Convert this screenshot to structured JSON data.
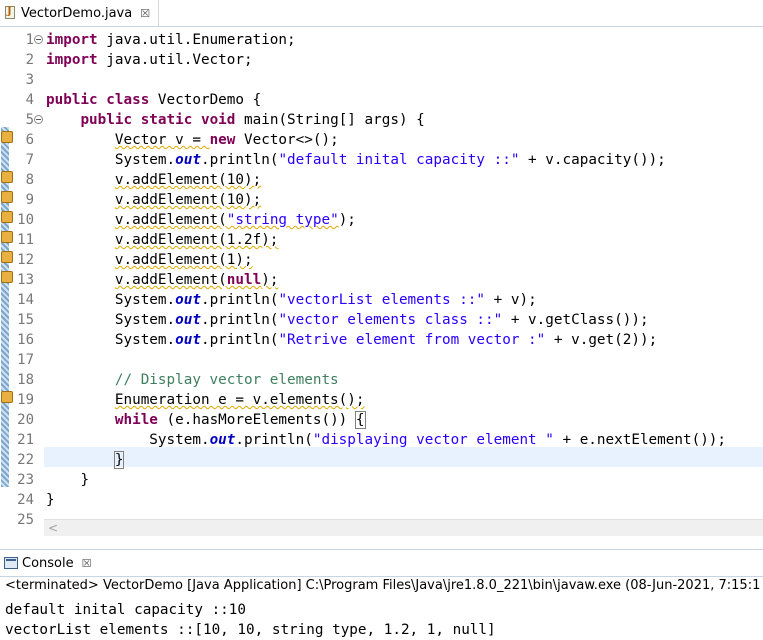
{
  "editor_tab": {
    "title": "VectorDemo.java",
    "close": "☒"
  },
  "lines": [
    {
      "n": "1"
    },
    {
      "n": "2"
    },
    {
      "n": "3"
    },
    {
      "n": "4"
    },
    {
      "n": "5"
    },
    {
      "n": "6"
    },
    {
      "n": "7"
    },
    {
      "n": "8"
    },
    {
      "n": "9"
    },
    {
      "n": "10"
    },
    {
      "n": "11"
    },
    {
      "n": "12"
    },
    {
      "n": "13"
    },
    {
      "n": "14"
    },
    {
      "n": "15"
    },
    {
      "n": "16"
    },
    {
      "n": "17"
    },
    {
      "n": "18"
    },
    {
      "n": "19"
    },
    {
      "n": "20"
    },
    {
      "n": "21"
    },
    {
      "n": "22"
    },
    {
      "n": "23"
    },
    {
      "n": "24"
    },
    {
      "n": "25"
    }
  ],
  "code": {
    "l1": [
      "import",
      " java.util.Enumeration;"
    ],
    "l2": [
      "import",
      " java.util.Vector;"
    ],
    "l4": [
      "public",
      "class",
      " VectorDemo {"
    ],
    "l5": [
      "public",
      "static",
      "void",
      " main(String[] args) {"
    ],
    "l6": [
      "Vector v = ",
      "new",
      " Vector<>();"
    ],
    "l7": [
      "System.",
      "out",
      ".println(",
      "\"default inital capacity ::\"",
      " + v.capacity());"
    ],
    "l8": [
      "v.addElement(10);"
    ],
    "l9": [
      "v.addElement(10);"
    ],
    "l10": [
      "v.addElement(",
      "\"string type\"",
      ");"
    ],
    "l11": [
      "v.addElement(1.2f);"
    ],
    "l12": [
      "v.addElement(1);"
    ],
    "l13": [
      "v.addElement(",
      "null",
      ");"
    ],
    "l14": [
      "System.",
      "out",
      ".println(",
      "\"vectorList elements ::\"",
      " + v);"
    ],
    "l15": [
      "System.",
      "out",
      ".println(",
      "\"vector elements class ::\"",
      " + v.getClass());"
    ],
    "l16": [
      "System.",
      "out",
      ".println(",
      "\"Retrive element from vector :\"",
      " + v.get(2));"
    ],
    "l18": [
      "// Display vector elements"
    ],
    "l19": [
      "Enumeration e = v.elements();"
    ],
    "l20": [
      "while",
      " (e.hasMoreElements()) ",
      "{"
    ],
    "l21": [
      "System.",
      "out",
      ".println(",
      "\"displaying vector element \"",
      " + e.nextElement());"
    ],
    "l22": [
      "}"
    ],
    "l23": [
      "}"
    ],
    "l24": [
      "}"
    ]
  },
  "console": {
    "tab_title": "Console",
    "close": "☒",
    "status": "<terminated> VectorDemo [Java Application] C:\\Program Files\\Java\\jre1.8.0_221\\bin\\javaw.exe (08-Jun-2021, 7:15:1",
    "output": [
      "default inital capacity ::10",
      "vectorList elements ::[10, 10, string type, 1.2, 1, null]"
    ]
  },
  "colors": {
    "keyword": "#7f0055",
    "string": "#2a00ff",
    "comment": "#3f7f5f",
    "field": "#0000c0",
    "current_line": "#e8f2fe"
  }
}
